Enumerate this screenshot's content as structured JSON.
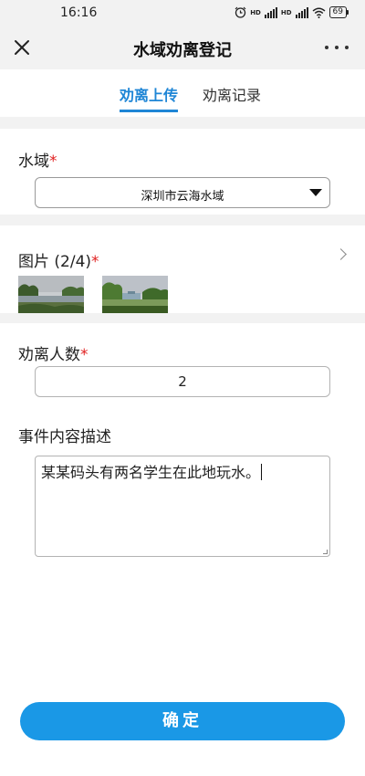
{
  "status_bar": {
    "time": "16:16",
    "net_label_1": "HD",
    "net_label_2": "HD",
    "battery": "69"
  },
  "nav": {
    "title": "水域劝离登记"
  },
  "tabs": [
    {
      "label": "劝离上传",
      "active": true
    },
    {
      "label": "劝离记录",
      "active": false
    }
  ],
  "form": {
    "water_area": {
      "label": "水域",
      "required_mark": "*",
      "selected": "深圳市云海水域"
    },
    "images": {
      "label": "图片 (2/4)",
      "required_mark": "*"
    },
    "persuade_count": {
      "label": "劝离人数",
      "required_mark": "*",
      "value": "2"
    },
    "description": {
      "label": "事件内容描述",
      "value": "某某码头有两名学生在此地玩水。"
    }
  },
  "confirm_button": "确定",
  "colors": {
    "accent": "#1f86d6",
    "button": "#1a98e6",
    "required": "#e02020",
    "section_gap": "#f2f2f2"
  }
}
